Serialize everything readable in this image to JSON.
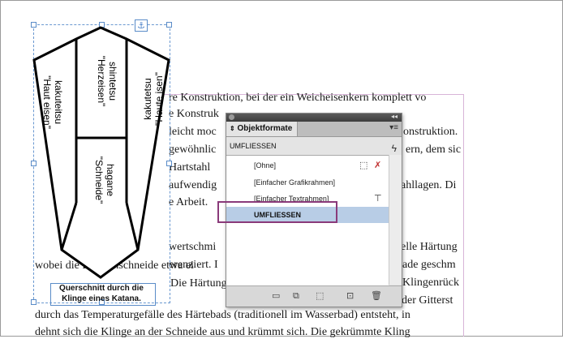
{
  "body_text": {
    "lines": [
      "re Konstruktion, bei der ein Weicheisenkern komplett vo",
      "e Konstruk",
      "leicht moc",
      "gewöhnlic",
      "Hartstahl",
      "aufwendig",
      "e Arbeit.",
      "",
      "wertschmi",
      "erenziert. I",
      "wobei die Klingenschneide etwa ei"
    ],
    "right_lines": [
      "onstruktion.",
      "ern, dem sic",
      "",
      "ahllagen. Di",
      "",
      "",
      "",
      "elle Härtung",
      "ade geschm",
      "Klingenrück"
    ],
    "tail_fragment": "Die Härtung",
    "tail_right": "der Gitterst",
    "bottom_lines": [
      "durch das Temperaturgefälle des Härtebads (traditionell im Wasserbad) entsteht, in",
      "dehnt sich die Klinge an der Schneide aus und krümmt sich. Die gekrümmte Kling"
    ]
  },
  "diagram": {
    "labels": {
      "left": "kakuteitsu\n\"Haut eisen\"",
      "center_top": "shintetsu\n\"Herzeisen\"",
      "right": "kakutetsu\n\"Haute isen\"",
      "center_bottom": "hagane\n\"Schneide\""
    },
    "caption": [
      "Querschnitt durch die",
      "Klinge eines Katana."
    ],
    "anchor_icon": "anchor-icon"
  },
  "panel": {
    "tab_label": "Objektformate",
    "current_style": "UMFLIESSEN",
    "items": [
      {
        "label": "[Ohne]",
        "selected": false,
        "icons": [
          "frame-icon",
          "no-style-icon"
        ]
      },
      {
        "label": "[Einfacher Grafikrahmen]",
        "selected": false,
        "icons": []
      },
      {
        "label": "[Einfacher Textrahmen]",
        "selected": false,
        "icons": [
          "text-frame-icon"
        ]
      },
      {
        "label": "UMFLIESSEN",
        "selected": true,
        "icons": []
      }
    ],
    "footer_icons": [
      "new-group-icon",
      "load-style-icon",
      "clear-overrides-icon",
      "new-style-icon",
      "trash-icon"
    ],
    "highlight_color": "#8a3a7a",
    "selection_color": "#b8cde6"
  }
}
